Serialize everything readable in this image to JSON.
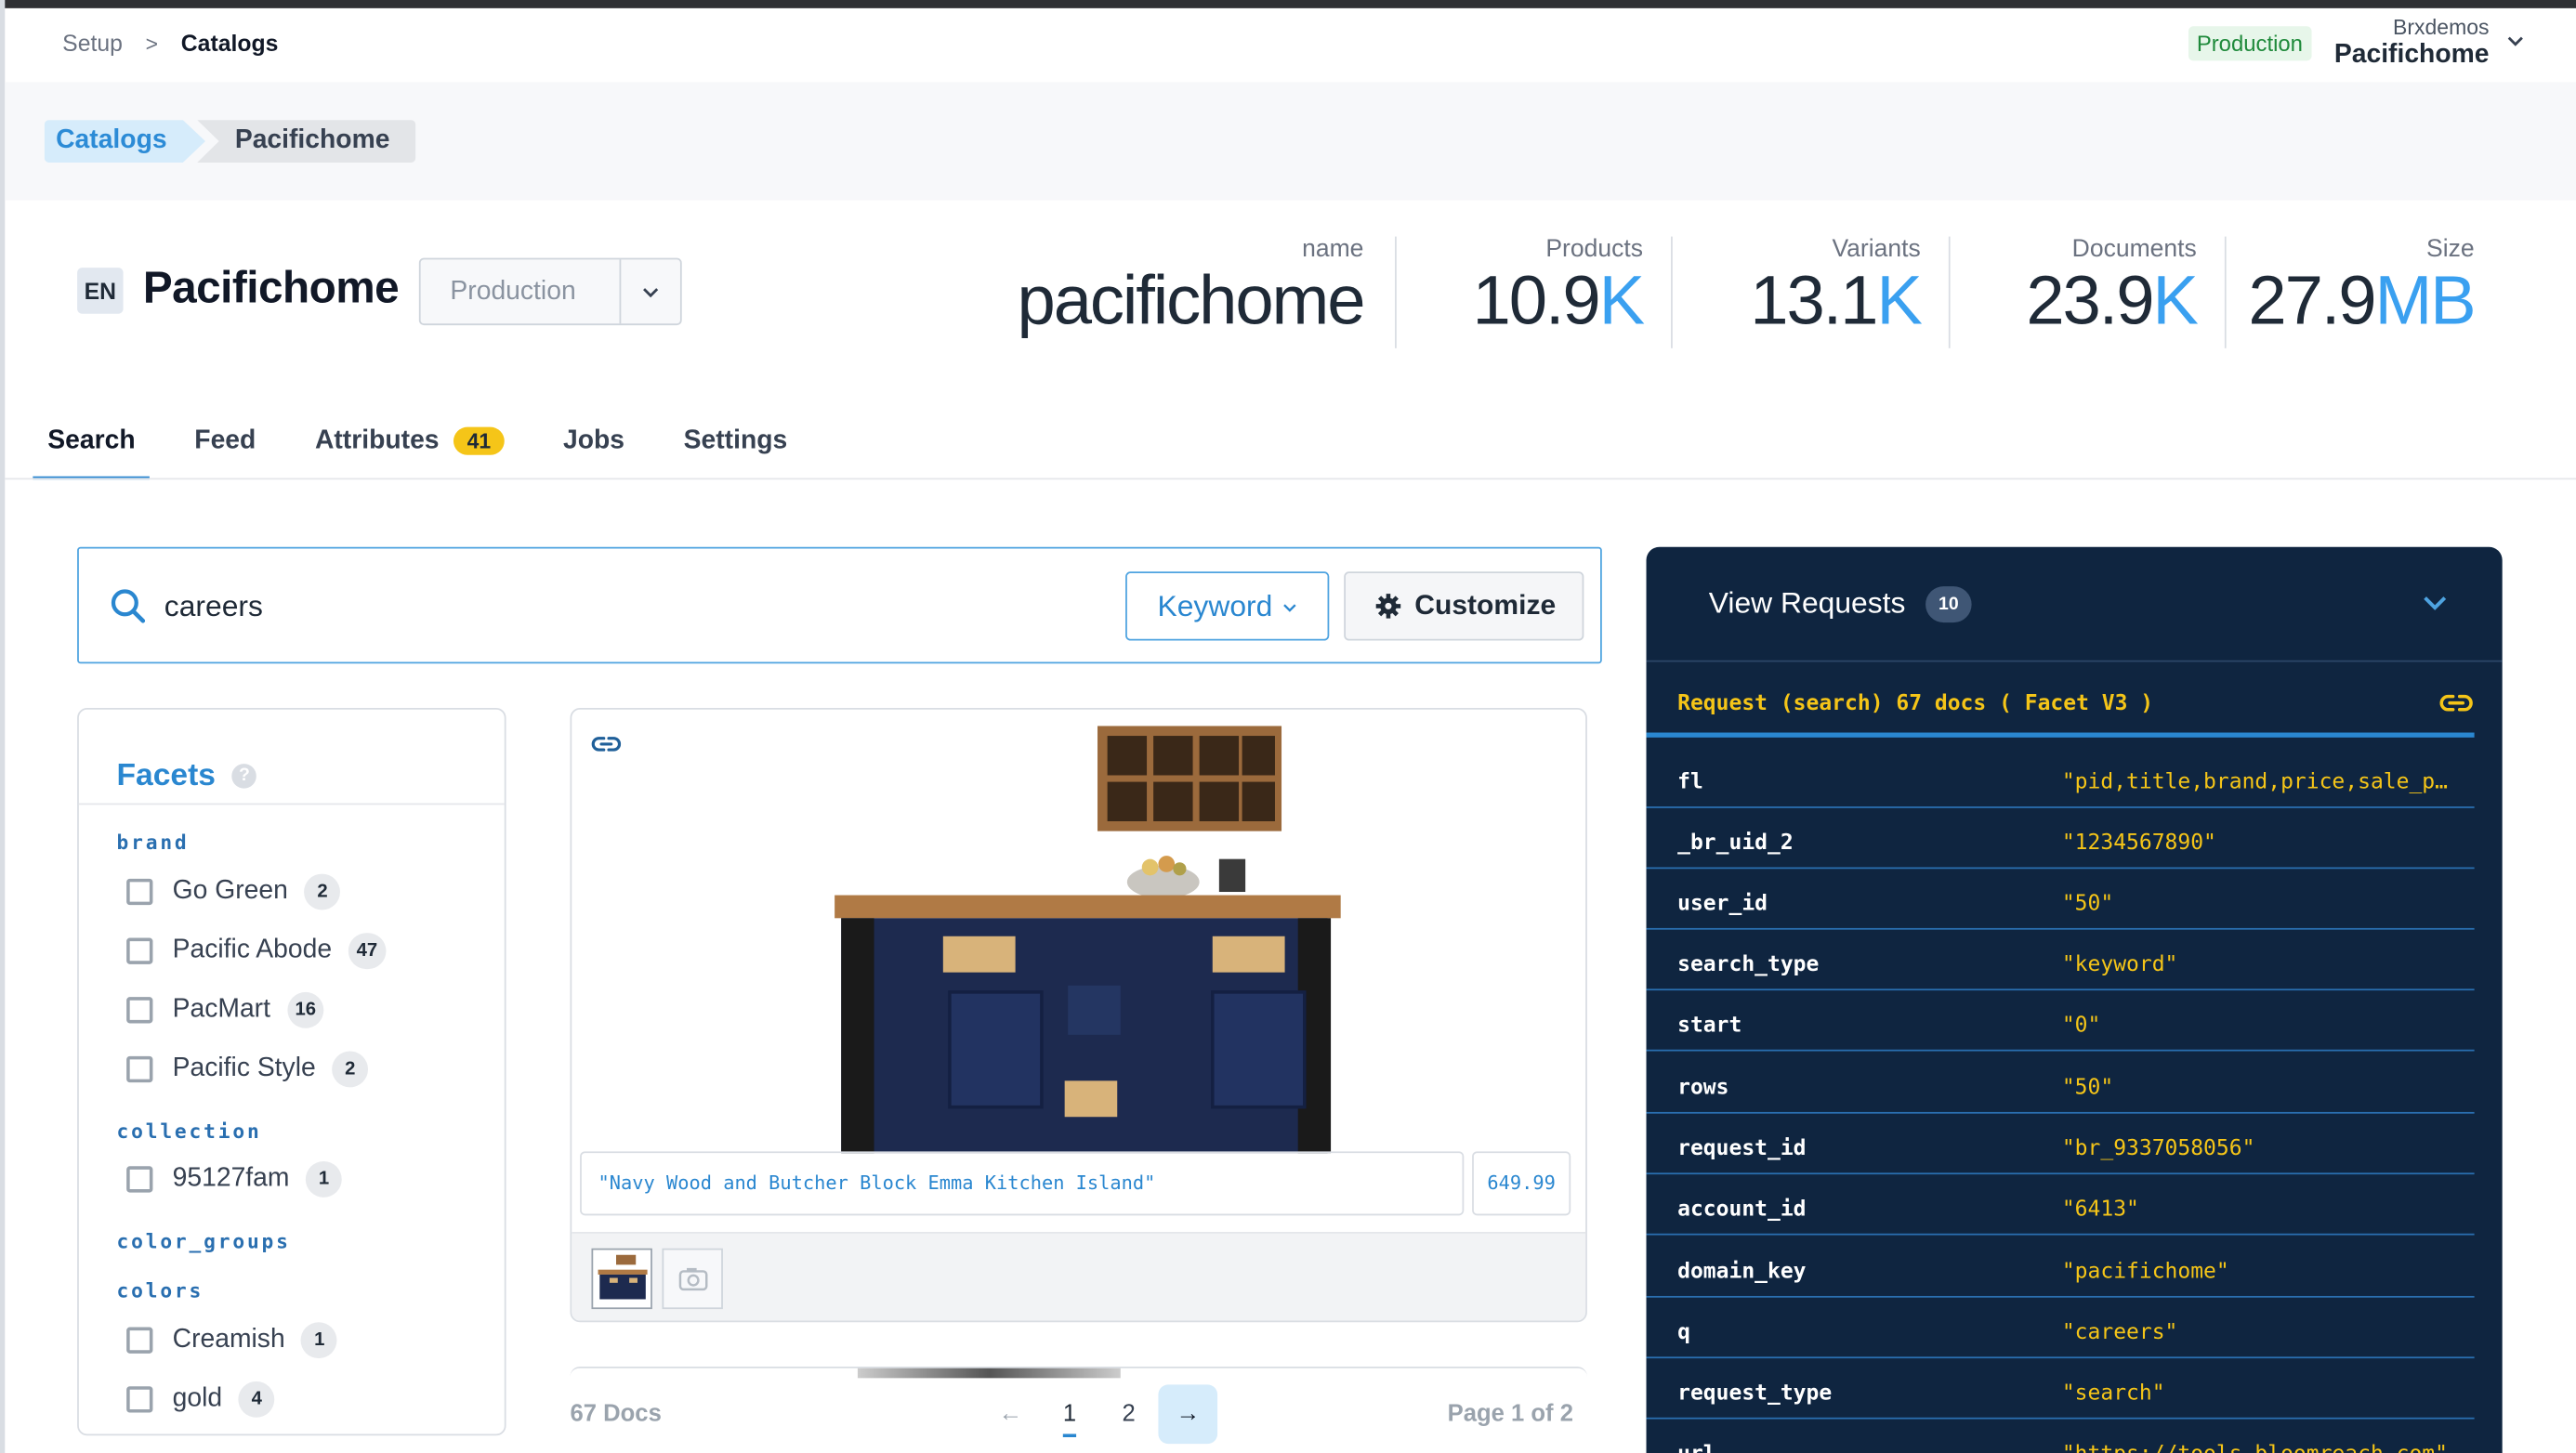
{
  "breadcrumb": {
    "setup": "Setup",
    "separator": ">",
    "current": "Catalogs"
  },
  "account": {
    "env_badge": "Production",
    "org": "Brxdemos",
    "name": "Pacifichome"
  },
  "path_pills": {
    "first": "Catalogs",
    "second": "Pacifichome"
  },
  "catalog": {
    "lang": "EN",
    "title": "Pacifichome",
    "env_select": "Production"
  },
  "stats": [
    {
      "label": "name",
      "value": "pacifichome",
      "unit": ""
    },
    {
      "label": "Products",
      "value": "10.9",
      "unit": "K"
    },
    {
      "label": "Variants",
      "value": "13.1",
      "unit": "K"
    },
    {
      "label": "Documents",
      "value": "23.9",
      "unit": "K"
    },
    {
      "label": "Size",
      "value": "27.9",
      "unit": "MB"
    }
  ],
  "tabs": [
    {
      "label": "Search"
    },
    {
      "label": "Feed"
    },
    {
      "label": "Attributes",
      "badge": "41"
    },
    {
      "label": "Jobs"
    },
    {
      "label": "Settings"
    }
  ],
  "search": {
    "query": "careers",
    "mode": "Keyword",
    "customize": "Customize"
  },
  "facets": {
    "title": "Facets",
    "help": "?",
    "groups": [
      {
        "name": "brand",
        "items": [
          {
            "label": "Go Green",
            "count": "2"
          },
          {
            "label": "Pacific Abode",
            "count": "47"
          },
          {
            "label": "PacMart",
            "count": "16"
          },
          {
            "label": "Pacific Style",
            "count": "2"
          }
        ]
      },
      {
        "name": "collection",
        "items": [
          {
            "label": "95127fam",
            "count": "1"
          }
        ]
      },
      {
        "name": "color_groups",
        "items": []
      },
      {
        "name": "colors",
        "items": [
          {
            "label": "Creamish",
            "count": "1"
          },
          {
            "label": "gold",
            "count": "4"
          }
        ]
      }
    ]
  },
  "product": {
    "title": "\"Navy Wood and Butcher Block Emma Kitchen Island\"",
    "price": "649.99"
  },
  "results": {
    "docs": "67 Docs",
    "pages": [
      "1",
      "2"
    ],
    "page_of": "Page 1 of 2"
  },
  "requests": {
    "title": "View Requests",
    "count": "10",
    "request_line": "Request (search) 67 docs ( Facet V3 )",
    "params": [
      {
        "key": "fl",
        "value": "\"pid,title,brand,price,sale_price,thumb_image\""
      },
      {
        "key": "_br_uid_2",
        "value": "\"1234567890\""
      },
      {
        "key": "user_id",
        "value": "\"50\""
      },
      {
        "key": "search_type",
        "value": "\"keyword\""
      },
      {
        "key": "start",
        "value": "\"0\""
      },
      {
        "key": "rows",
        "value": "\"50\""
      },
      {
        "key": "request_id",
        "value": "\"br_9337058056\""
      },
      {
        "key": "account_id",
        "value": "\"6413\""
      },
      {
        "key": "domain_key",
        "value": "\"pacifichome\""
      },
      {
        "key": "q",
        "value": "\"careers\""
      },
      {
        "key": "request_type",
        "value": "\"search\""
      },
      {
        "key": "url",
        "value": "\"https://tools.bloomreach.com\""
      }
    ]
  }
}
